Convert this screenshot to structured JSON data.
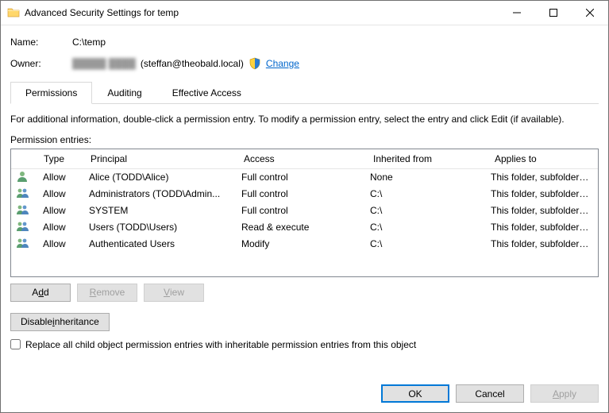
{
  "window": {
    "title": "Advanced Security Settings for temp"
  },
  "header": {
    "name_label": "Name:",
    "name_value": "C:\\temp",
    "owner_label": "Owner:",
    "owner_display_redacted": "█████ ████",
    "owner_display_suffix": "(steffan@theobald.local)",
    "change_label": "Change"
  },
  "tabs": {
    "permissions": "Permissions",
    "auditing": "Auditing",
    "effective": "Effective Access",
    "active": "permissions"
  },
  "info_text": "For additional information, double-click a permission entry. To modify a permission entry, select the entry and click Edit (if available).",
  "entries_label": "Permission entries:",
  "columns": {
    "type": "Type",
    "principal": "Principal",
    "access": "Access",
    "inherited": "Inherited from",
    "applies": "Applies to"
  },
  "entries": [
    {
      "type": "Allow",
      "principal": "Alice (TODD\\Alice)",
      "access": "Full control",
      "inherited": "None",
      "applies": "This folder, subfolders and files",
      "icon": "person"
    },
    {
      "type": "Allow",
      "principal": "Administrators (TODD\\Admin...",
      "access": "Full control",
      "inherited": "C:\\",
      "applies": "This folder, subfolders and files",
      "icon": "group"
    },
    {
      "type": "Allow",
      "principal": "SYSTEM",
      "access": "Full control",
      "inherited": "C:\\",
      "applies": "This folder, subfolders and files",
      "icon": "group"
    },
    {
      "type": "Allow",
      "principal": "Users (TODD\\Users)",
      "access": "Read & execute",
      "inherited": "C:\\",
      "applies": "This folder, subfolders and files",
      "icon": "group"
    },
    {
      "type": "Allow",
      "principal": "Authenticated Users",
      "access": "Modify",
      "inherited": "C:\\",
      "applies": "This folder, subfolders and files",
      "icon": "group"
    }
  ],
  "buttons": {
    "add": "Add",
    "remove": "Remove",
    "view": "View",
    "disable_inheritance": "Disable inheritance",
    "ok": "OK",
    "cancel": "Cancel",
    "apply": "Apply"
  },
  "replace_checkbox_label": "Replace all child object permission entries with inheritable permission entries from this object",
  "replace_checked": false
}
